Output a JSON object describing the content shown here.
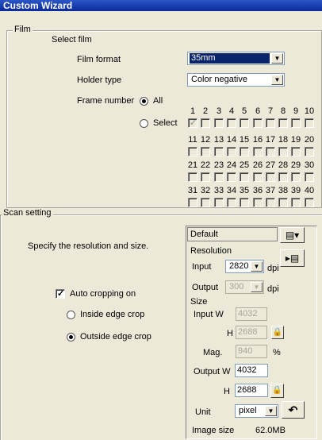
{
  "window": {
    "title": "Custom Wizard"
  },
  "film": {
    "group_label": "Film",
    "select_label": "Select film",
    "format_label": "Film format",
    "format_value": "35mm",
    "holder_label": "Holder type",
    "holder_value": "Color negative",
    "frame_label": "Frame number",
    "all_label": "All",
    "select_radio_label": "Select",
    "frames": [
      "1",
      "2",
      "3",
      "4",
      "5",
      "6",
      "7",
      "8",
      "9",
      "10",
      "11",
      "12",
      "13",
      "14",
      "15",
      "16",
      "17",
      "18",
      "19",
      "20",
      "21",
      "22",
      "23",
      "24",
      "25",
      "26",
      "27",
      "28",
      "29",
      "30",
      "31",
      "32",
      "33",
      "34",
      "35",
      "36",
      "37",
      "38",
      "39",
      "40"
    ]
  },
  "scan": {
    "group_label": "Scan setting",
    "instruction": "Specify the resolution and size.",
    "auto_crop_label": "Auto cropping on",
    "inside_label": "Inside edge crop",
    "outside_label": "Outside edge crop",
    "preset": "Default",
    "resolution_label": "Resolution",
    "input_label": "Input",
    "input_value": "2820",
    "dpi": "dpi",
    "output_label": "Output",
    "output_value": "300",
    "size_label": "Size",
    "input_w_label": "Input W",
    "input_w_value": "4032",
    "h_label": "H",
    "input_h_value": "2688",
    "mag_label": "Mag.",
    "mag_value": "940",
    "percent": "%",
    "output_w_label": "Output W",
    "output_w_value": "4032",
    "output_h_value": "2688",
    "unit_label": "Unit",
    "unit_value": "pixel",
    "image_size_label": "Image size",
    "image_size_value": "62.0MB"
  }
}
